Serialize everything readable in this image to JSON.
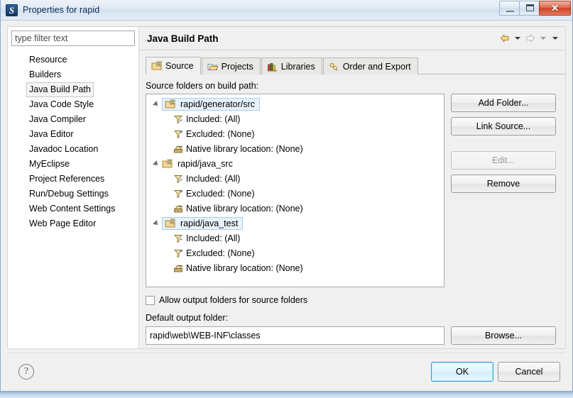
{
  "window": {
    "title": "Properties for rapid",
    "app_icon": "myeclipse-icon",
    "controls": {
      "minimize": "minimize-icon",
      "maximize": "restore-icon",
      "close": "✕"
    }
  },
  "sidebar": {
    "filter": {
      "value": "",
      "placeholder": "type filter text"
    },
    "items": [
      {
        "label": "Resource",
        "selected": false
      },
      {
        "label": "Builders",
        "selected": false
      },
      {
        "label": "Java Build Path",
        "selected": true
      },
      {
        "label": "Java Code Style",
        "selected": false
      },
      {
        "label": "Java Compiler",
        "selected": false
      },
      {
        "label": "Java Editor",
        "selected": false
      },
      {
        "label": "Javadoc Location",
        "selected": false
      },
      {
        "label": "MyEclipse",
        "selected": false
      },
      {
        "label": "Project References",
        "selected": false
      },
      {
        "label": "Run/Debug Settings",
        "selected": false
      },
      {
        "label": "Web Content Settings",
        "selected": false
      },
      {
        "label": "Web Page Editor",
        "selected": false
      }
    ]
  },
  "page": {
    "title": "Java Build Path",
    "nav": {
      "back": "back-arrow-icon",
      "back_menu": "chevron-down-icon",
      "forward": "forward-arrow-icon",
      "forward_menu": "chevron-down-icon",
      "view_menu": "chevron-down-icon"
    }
  },
  "tabs": [
    {
      "label": "Source",
      "icon": "source-folder-icon",
      "active": true
    },
    {
      "label": "Projects",
      "icon": "projects-folder-icon",
      "active": false
    },
    {
      "label": "Libraries",
      "icon": "libraries-books-icon",
      "active": false
    },
    {
      "label": "Order and Export",
      "icon": "order-export-icon",
      "active": false
    }
  ],
  "source_tab": {
    "tree_label": "Source folders on build path:",
    "tree": [
      {
        "name": "rapid/generator/src",
        "icon": "source-folder-icon",
        "selected": true,
        "expanded": true,
        "children": [
          {
            "label": "Included: (All)",
            "icon": "included-filter-icon"
          },
          {
            "label": "Excluded: (None)",
            "icon": "excluded-filter-icon"
          },
          {
            "label": "Native library location: (None)",
            "icon": "native-library-icon"
          }
        ]
      },
      {
        "name": "rapid/java_src",
        "icon": "source-folder-icon",
        "selected": false,
        "expanded": true,
        "children": [
          {
            "label": "Included: (All)",
            "icon": "included-filter-icon"
          },
          {
            "label": "Excluded: (None)",
            "icon": "excluded-filter-icon"
          },
          {
            "label": "Native library location: (None)",
            "icon": "native-library-icon"
          }
        ]
      },
      {
        "name": "rapid/java_test",
        "icon": "source-folder-icon",
        "selected": true,
        "expanded": true,
        "children": [
          {
            "label": "Included: (All)",
            "icon": "included-filter-icon"
          },
          {
            "label": "Excluded: (None)",
            "icon": "excluded-filter-icon"
          },
          {
            "label": "Native library location: (None)",
            "icon": "native-library-icon"
          }
        ]
      }
    ],
    "buttons": [
      {
        "label": "Add Folder...",
        "enabled": true
      },
      {
        "label": "Link Source...",
        "enabled": true
      },
      {
        "label": "Edit...",
        "enabled": false
      },
      {
        "label": "Remove",
        "enabled": true
      }
    ],
    "allow_output_checkbox": {
      "label": "Allow output folders for source folders",
      "checked": false
    },
    "default_output_label": "Default output folder:",
    "default_output_value": "rapid\\web\\WEB-INF\\classes",
    "browse_label": "Browse..."
  },
  "footer": {
    "help": "?",
    "ok": "OK",
    "cancel": "Cancel"
  },
  "colors": {
    "accent_blue": "#2f9bd4",
    "selection_blue": "#e8f2fb",
    "close_red": "#cf4327",
    "dialog_bg": "#f0f0f0"
  }
}
